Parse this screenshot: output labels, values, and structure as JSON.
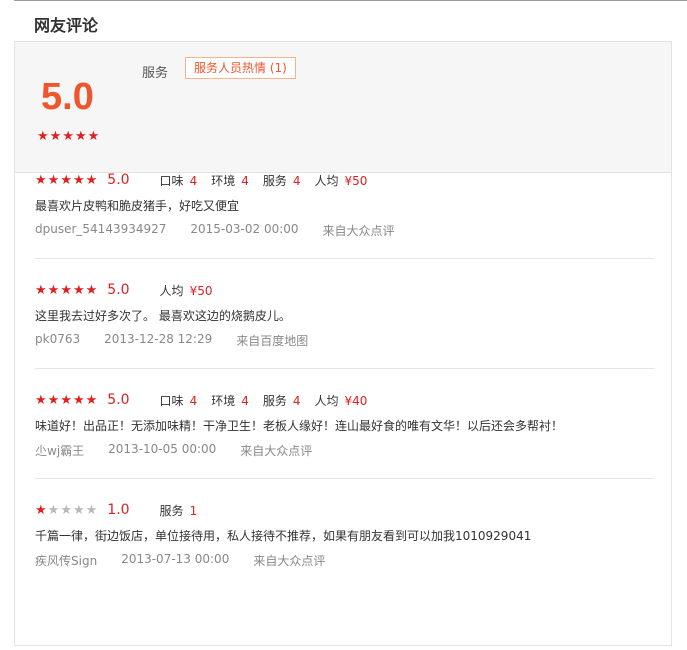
{
  "section_title": "网友评论",
  "summary": {
    "score": "5.0",
    "stars": 5,
    "service_label": "服务",
    "tag": "服务人员热情 (1)"
  },
  "reviews": [
    {
      "stars": 5,
      "score": "5.0",
      "metrics": [
        {
          "label": "口味",
          "value": "4"
        },
        {
          "label": "环境",
          "value": "4"
        },
        {
          "label": "服务",
          "value": "4"
        },
        {
          "label": "人均",
          "value": "¥50"
        }
      ],
      "text": "最喜欢片皮鸭和脆皮猪手，好吃又便宜",
      "user": "dpuser_54143934927",
      "time": "2015-03-02 00:00",
      "source": "来自大众点评"
    },
    {
      "stars": 5,
      "score": "5.0",
      "metrics": [
        {
          "label": "人均",
          "value": "¥50"
        }
      ],
      "text": "这里我去过好多次了。 最喜欢这边的烧鹅皮儿。",
      "user": "pk0763",
      "time": "2013-12-28 12:29",
      "source": "来自百度地图"
    },
    {
      "stars": 5,
      "score": "5.0",
      "metrics": [
        {
          "label": "口味",
          "value": "4"
        },
        {
          "label": "环境",
          "value": "4"
        },
        {
          "label": "服务",
          "value": "4"
        },
        {
          "label": "人均",
          "value": "¥40"
        }
      ],
      "text": "味道好！出品正！无添加味精！干净卫生！老板人缘好！连山最好食的唯有文华！以后还会多帮衬！",
      "user": "尐wj霸王",
      "time": "2013-10-05 00:00",
      "source": "来自大众点评"
    },
    {
      "stars": 1,
      "score": "1.0",
      "metrics": [
        {
          "label": "服务",
          "value": "1"
        }
      ],
      "text": "千篇一律，街边饭店，单位接待用，私人接待不推荐，如果有朋友看到可以加我1010929041",
      "user": "疾风传Sign",
      "time": "2013-07-13 00:00",
      "source": "来自大众点评"
    }
  ],
  "colors": {
    "accent": "#f0562c",
    "star_on": "#e02020",
    "star_off": "#b9b9b9"
  }
}
